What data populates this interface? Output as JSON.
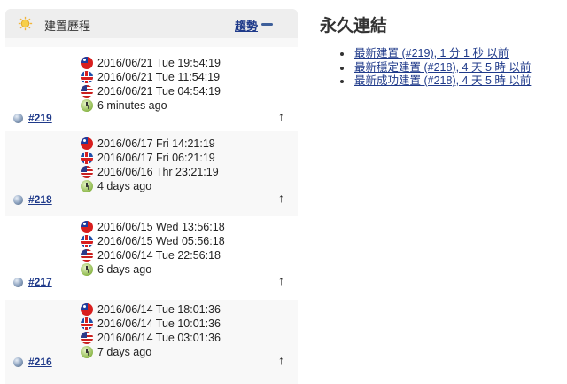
{
  "build_history": {
    "title": "建置歷程",
    "trend_label": "趨勢",
    "builds": [
      {
        "number": "#219",
        "times": [
          {
            "flag": "taiwan-flag-icon",
            "text": "2016/06/21 Tue 19:54:19"
          },
          {
            "flag": "iceland-flag-icon",
            "text": "2016/06/21 Tue 11:54:19"
          },
          {
            "flag": "us-flag-icon",
            "text": "2016/06/21 Tue 04:54:19"
          }
        ],
        "ago": "6 minutes ago"
      },
      {
        "number": "#218",
        "times": [
          {
            "flag": "taiwan-flag-icon",
            "text": "2016/06/17 Fri 14:21:19"
          },
          {
            "flag": "iceland-flag-icon",
            "text": "2016/06/17 Fri 06:21:19"
          },
          {
            "flag": "us-flag-icon",
            "text": "2016/06/16 Thr 23:21:19"
          }
        ],
        "ago": "4 days ago"
      },
      {
        "number": "#217",
        "times": [
          {
            "flag": "taiwan-flag-icon",
            "text": "2016/06/15 Wed 13:56:18"
          },
          {
            "flag": "iceland-flag-icon",
            "text": "2016/06/15 Wed 05:56:18"
          },
          {
            "flag": "us-flag-icon",
            "text": "2016/06/14 Tue 22:56:18"
          }
        ],
        "ago": "6 days ago"
      },
      {
        "number": "#216",
        "times": [
          {
            "flag": "taiwan-flag-icon",
            "text": "2016/06/14 Tue 18:01:36"
          },
          {
            "flag": "iceland-flag-icon",
            "text": "2016/06/14 Tue 10:01:36"
          },
          {
            "flag": "us-flag-icon",
            "text": "2016/06/14 Tue 03:01:36"
          }
        ],
        "ago": "7 days ago"
      }
    ],
    "up_arrow": "↑"
  },
  "permalinks": {
    "title": "永久連結",
    "items": [
      "最新建置 (#219), 1 分 1 秒 以前",
      "最新穩定建置 (#218), 4 天 5 時 以前",
      "最新成功建置 (#218), 4 天 5 時 以前"
    ]
  }
}
